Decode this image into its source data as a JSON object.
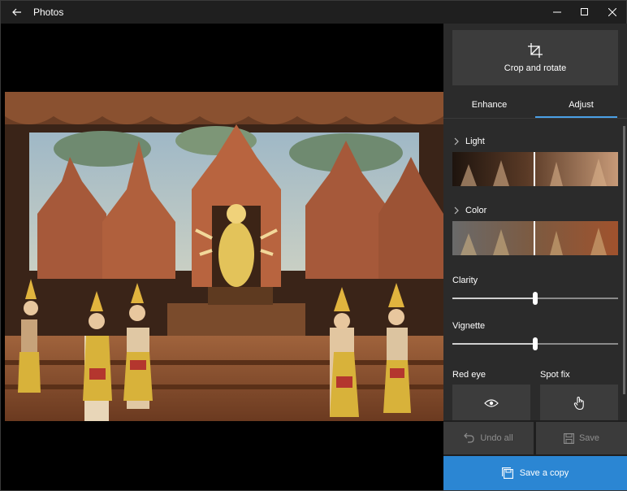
{
  "window": {
    "title": "Photos"
  },
  "panel": {
    "crop_label": "Crop and rotate",
    "tabs": [
      {
        "label": "Enhance",
        "active": false
      },
      {
        "label": "Adjust",
        "active": true
      }
    ],
    "sections": {
      "light_label": "Light",
      "color_label": "Color"
    },
    "sliders": {
      "clarity": {
        "label": "Clarity",
        "value": 0.5
      },
      "vignette": {
        "label": "Vignette",
        "value": 0.5
      }
    },
    "tools": {
      "red_eye_label": "Red eye",
      "spot_fix_label": "Spot fix"
    }
  },
  "actions": {
    "undo_label": "Undo all",
    "save_label": "Save",
    "save_copy_label": "Save a copy"
  },
  "colors": {
    "accent": "#2b86d3",
    "tab_underline": "#4aa0e6",
    "panel_bg": "#2b2b2b"
  }
}
